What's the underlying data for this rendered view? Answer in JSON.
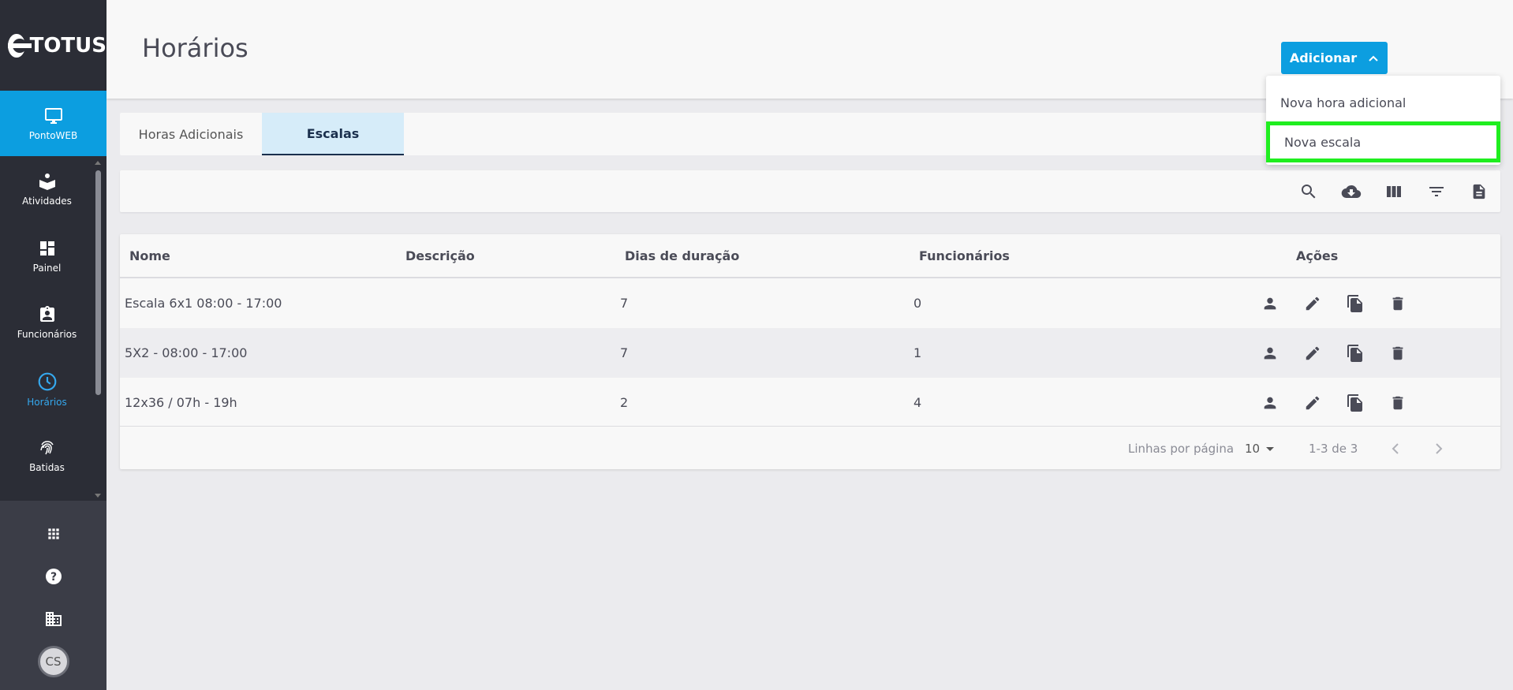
{
  "brand": {
    "logo_text": "TOTUS"
  },
  "sidebar": {
    "app": {
      "label": "PontoWEB",
      "icon": "monitor-icon"
    },
    "items": [
      {
        "label": "Atividades",
        "icon": "activities-icon"
      },
      {
        "label": "Painel",
        "icon": "dashboard-icon"
      },
      {
        "label": "Funcionários",
        "icon": "badge-icon"
      },
      {
        "label": "Horários",
        "icon": "clock-icon"
      },
      {
        "label": "Batidas",
        "icon": "fingerprint-icon"
      }
    ],
    "bottom": [
      "apps-grid-icon",
      "help-icon",
      "building-icon"
    ],
    "avatar_initials": "CS"
  },
  "header": {
    "title": "Horários",
    "add_label": "Adicionar"
  },
  "dropdown": {
    "items": [
      "Nova hora adicional",
      "Nova escala"
    ]
  },
  "tabs": [
    "Horas Adicionais",
    "Escalas"
  ],
  "toolbar": [
    "search-icon",
    "cloud-download-icon",
    "columns-icon",
    "filter-icon",
    "document-icon"
  ],
  "table": {
    "columns": [
      "Nome",
      "Descrição",
      "Dias de duração",
      "Funcionários",
      "Ações"
    ],
    "rows": [
      {
        "nome": "Escala 6x1 08:00 - 17:00",
        "descricao": "",
        "dias": "7",
        "funcionarios": "0"
      },
      {
        "nome": "5X2 - 08:00 - 17:00",
        "descricao": "",
        "dias": "7",
        "funcionarios": "1"
      },
      {
        "nome": "12x36 / 07h - 19h",
        "descricao": "",
        "dias": "2",
        "funcionarios": "4"
      }
    ],
    "footer": {
      "rows_per_page_label": "Linhas por página",
      "rows_per_page": "10",
      "range": "1-3 de 3"
    }
  },
  "colors": {
    "accent": "#0c9ee0",
    "sidebar": "#3b3d47",
    "highlight": "#1fee1f",
    "active_tab_bg": "#d6ecf9"
  }
}
